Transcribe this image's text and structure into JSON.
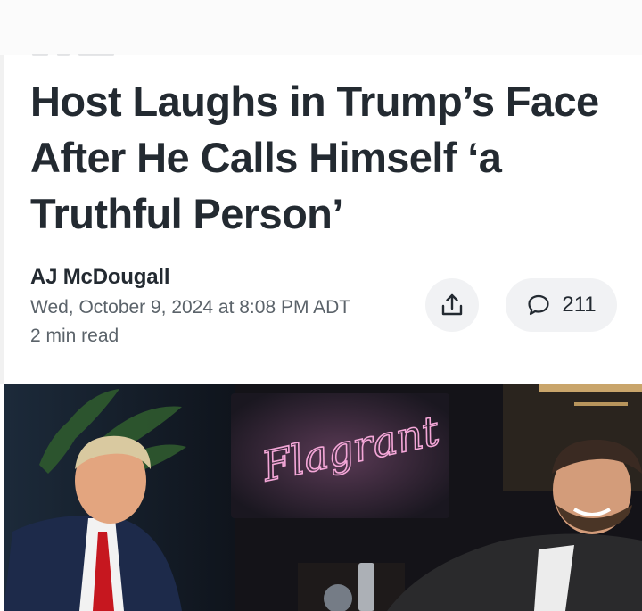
{
  "article": {
    "headline": "Host Laughs in Trump’s Face After He Calls Himself ‘a Truthful Person’",
    "author": "AJ McDougall",
    "date": "Wed, October 9, 2024 at 8:08 PM ADT",
    "read_time": "2 min read"
  },
  "actions": {
    "share_icon": "share-icon",
    "comment_icon": "comment-bubble-icon",
    "comment_count": "211"
  },
  "hero": {
    "sign_text": "Flagrant"
  },
  "colors": {
    "headline": "#232a31",
    "meta": "#5b636a",
    "button_bg": "#f1f2f4",
    "neon": "#f4a7d8"
  }
}
